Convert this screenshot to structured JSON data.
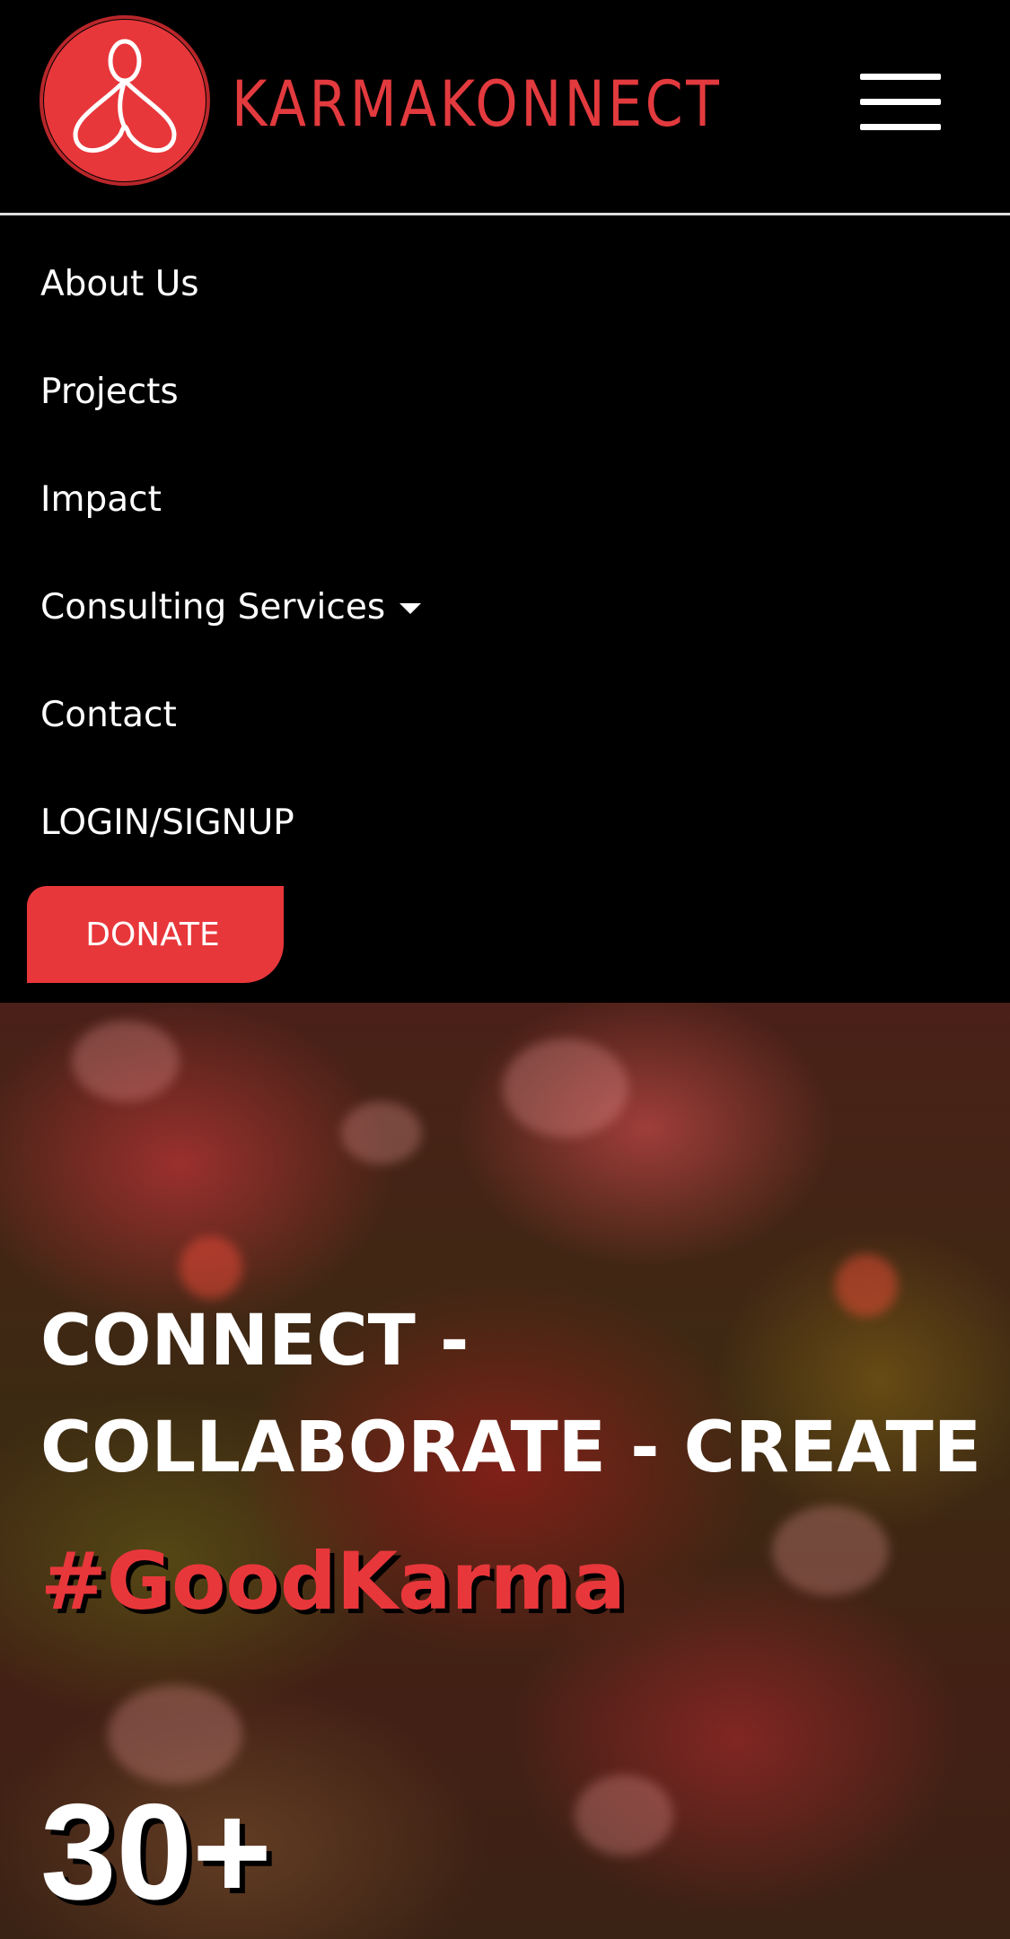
{
  "header": {
    "brand_name": "KARMAKONNECT",
    "logo_icon": "karmakonnect-logo-icon",
    "menu_icon": "hamburger-menu-icon"
  },
  "nav": {
    "items": [
      {
        "label": "About Us"
      },
      {
        "label": "Projects"
      },
      {
        "label": "Impact"
      },
      {
        "label": "Consulting Services",
        "icon": "caret-down-icon"
      },
      {
        "label": "Contact"
      },
      {
        "label": "LOGIN/SIGNUP"
      }
    ],
    "donate_label": "DONATE"
  },
  "hero": {
    "title": "CONNECT - COLLABORATE - CREATE",
    "hashtag": "#GoodKarma",
    "stat": "30+"
  },
  "colors": {
    "accent": "#e8373b",
    "background": "#000000",
    "text": "#ffffff"
  }
}
